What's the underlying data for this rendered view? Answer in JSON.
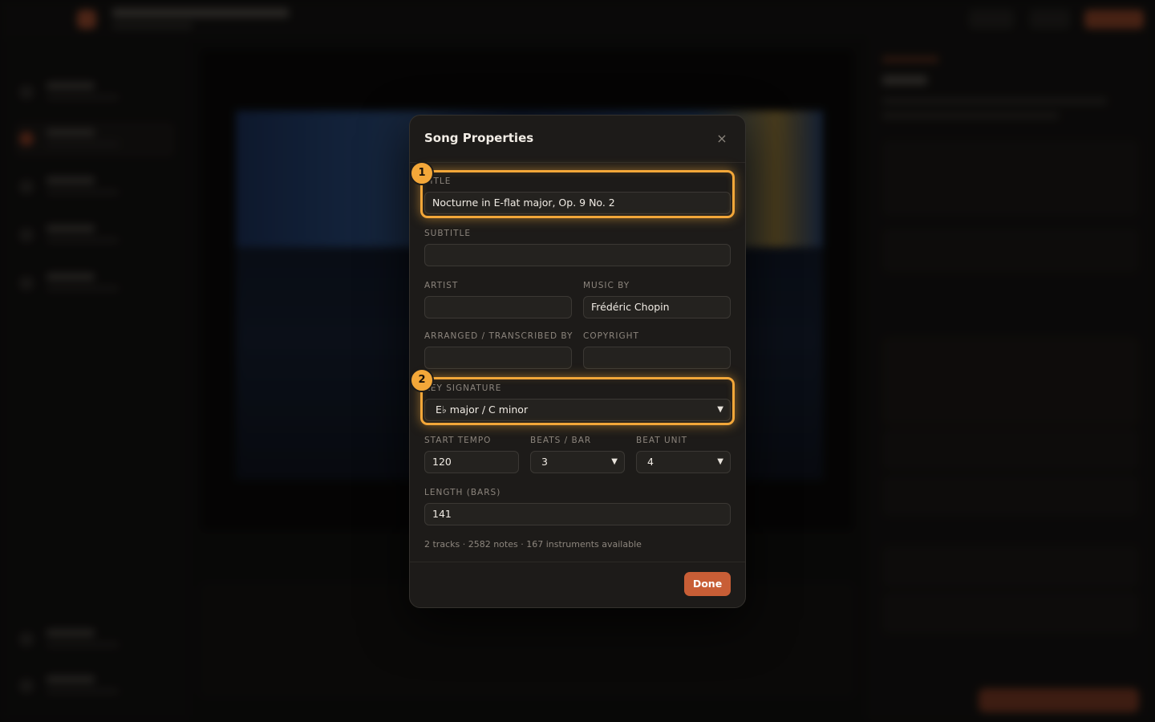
{
  "dialog": {
    "title": "Song Properties",
    "close_icon": "×",
    "fields": {
      "title": {
        "label": "TITLE",
        "value": "Nocturne in E-flat major, Op. 9 No. 2"
      },
      "subtitle": {
        "label": "SUBTITLE",
        "value": ""
      },
      "artist": {
        "label": "ARTIST",
        "value": ""
      },
      "music_by": {
        "label": "MUSIC BY",
        "value": "Frédéric Chopin"
      },
      "arranged_by": {
        "label": "ARRANGED / TRANSCRIBED BY",
        "value": ""
      },
      "copyright": {
        "label": "COPYRIGHT",
        "value": ""
      },
      "key_signature": {
        "label": "KEY SIGNATURE",
        "value": "E♭ major / C minor"
      },
      "start_tempo": {
        "label": "START TEMPO",
        "value": "120"
      },
      "beats_per_bar": {
        "label": "BEATS / BAR",
        "value": "3"
      },
      "beat_unit": {
        "label": "BEAT UNIT",
        "value": "4"
      },
      "length_bars": {
        "label": "LENGTH (BARS)",
        "value": "141"
      }
    },
    "summary": "2 tracks · 2582 notes · 167 instruments available",
    "done_label": "Done"
  },
  "annotations": {
    "badge_1": "1",
    "badge_2": "2"
  },
  "colors": {
    "accent": "#c85e36",
    "highlight": "#f3a739",
    "panel": "#1d1b19"
  }
}
